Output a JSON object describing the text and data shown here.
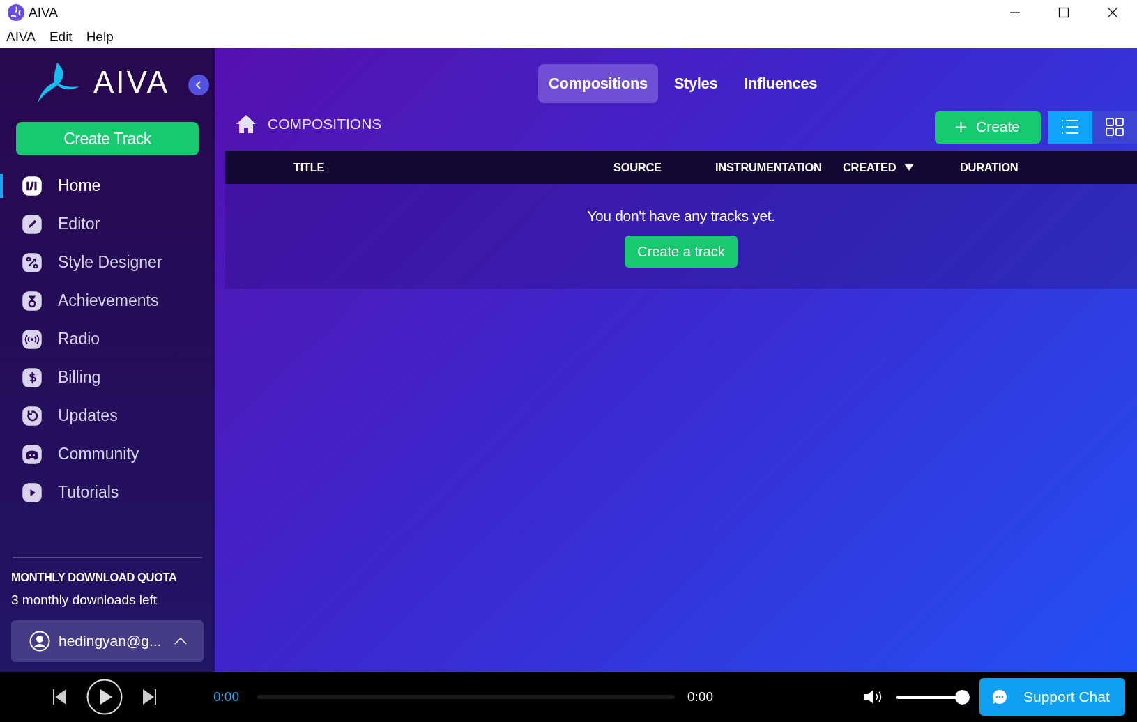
{
  "window": {
    "title": "AIVA"
  },
  "menu": [
    "AIVA",
    "Edit",
    "Help"
  ],
  "sidebar": {
    "logo_text": "AIVA",
    "create_button": "Create Track",
    "items": [
      {
        "label": "Home",
        "selected": true
      },
      {
        "label": "Editor",
        "selected": false
      },
      {
        "label": "Style Designer",
        "selected": false
      },
      {
        "label": "Achievements",
        "selected": false
      },
      {
        "label": "Radio",
        "selected": false
      },
      {
        "label": "Billing",
        "selected": false
      },
      {
        "label": "Updates",
        "selected": false
      },
      {
        "label": "Community",
        "selected": false
      },
      {
        "label": "Tutorials",
        "selected": false
      }
    ],
    "quota_title": "MONTHLY DOWNLOAD QUOTA",
    "quota_text": "3 monthly downloads left",
    "user": "hedingyan@g..."
  },
  "tabs": [
    {
      "label": "Compositions",
      "selected": true
    },
    {
      "label": "Styles",
      "selected": false
    },
    {
      "label": "Influences",
      "selected": false
    }
  ],
  "breadcrumb": "COMPOSITIONS",
  "create_button": "Create",
  "view_toggle": [
    {
      "kind": "list",
      "selected": true
    },
    {
      "kind": "grid",
      "selected": false
    }
  ],
  "table": {
    "columns": [
      {
        "label": "TITLE",
        "sorted": false
      },
      {
        "label": "SOURCE",
        "sorted": false
      },
      {
        "label": "INSTRUMENTATION",
        "sorted": false
      },
      {
        "label": "CREATED",
        "sorted": true
      },
      {
        "label": "DURATION",
        "sorted": false
      }
    ],
    "empty_message": "You don't have any tracks yet.",
    "empty_button": "Create a track"
  },
  "player": {
    "elapsed": "0:00",
    "level": 0,
    "total": "0:00",
    "volume": {
      "level": 1
    },
    "support_button": "Support Chat"
  }
}
